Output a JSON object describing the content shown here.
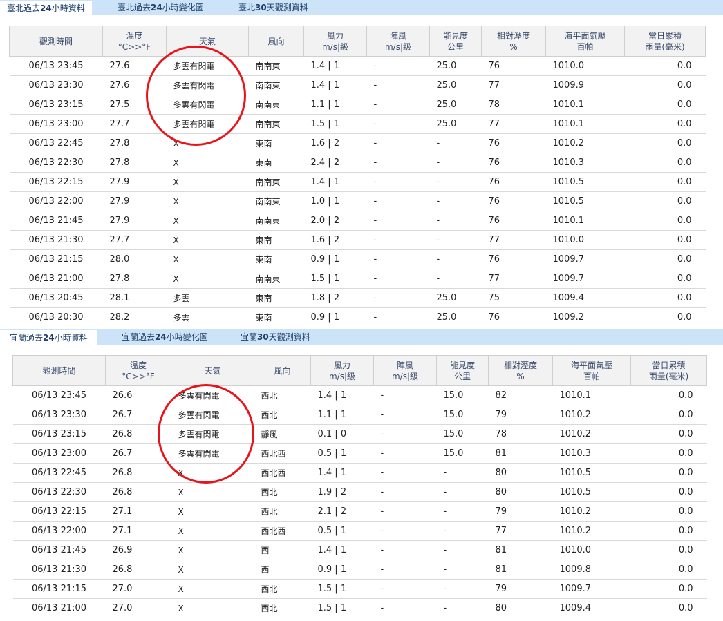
{
  "section1": {
    "tabs": [
      {
        "prefix": "臺北過去",
        "bold": "24",
        "suffix": "小時資料"
      },
      {
        "prefix": "臺北過去",
        "bold": "24",
        "suffix": "小時變化圖"
      },
      {
        "prefix": "臺北",
        "bold": "30",
        "suffix": "天觀測資料"
      }
    ],
    "headers": [
      [
        "觀測時間"
      ],
      [
        "溫度",
        "°C>>°F"
      ],
      [
        "天氣"
      ],
      [
        "風向"
      ],
      [
        "風力",
        "m/s|級"
      ],
      [
        "陣風",
        "m/s|級"
      ],
      [
        "能見度",
        "公里"
      ],
      [
        "相對溼度",
        "%"
      ],
      [
        "海平面氣壓",
        "百帕"
      ],
      [
        "當日累積",
        "雨量(毫米)"
      ]
    ],
    "rows": [
      [
        "06/13 23:45",
        "27.6",
        "多雲有閃電",
        "南南東",
        "1.4 | 1",
        "-",
        "25.0",
        "76",
        "1010.0",
        "0.0"
      ],
      [
        "06/13 23:30",
        "27.6",
        "多雲有閃電",
        "南南東",
        "1.4 | 1",
        "-",
        "25.0",
        "77",
        "1009.9",
        "0.0"
      ],
      [
        "06/13 23:15",
        "27.5",
        "多雲有閃電",
        "南南東",
        "1.1 | 1",
        "-",
        "25.0",
        "78",
        "1010.1",
        "0.0"
      ],
      [
        "06/13 23:00",
        "27.7",
        "多雲有閃電",
        "南南東",
        "1.5 | 1",
        "-",
        "25.0",
        "77",
        "1010.1",
        "0.0"
      ],
      [
        "06/13 22:45",
        "27.8",
        "X",
        "東南",
        "1.6 | 2",
        "-",
        "-",
        "76",
        "1010.2",
        "0.0"
      ],
      [
        "06/13 22:30",
        "27.8",
        "X",
        "東南",
        "2.4 | 2",
        "-",
        "-",
        "76",
        "1010.3",
        "0.0"
      ],
      [
        "06/13 22:15",
        "27.9",
        "X",
        "南南東",
        "1.4 | 1",
        "-",
        "-",
        "76",
        "1010.5",
        "0.0"
      ],
      [
        "06/13 22:00",
        "27.9",
        "X",
        "南南東",
        "1.0 | 1",
        "-",
        "-",
        "76",
        "1010.5",
        "0.0"
      ],
      [
        "06/13 21:45",
        "27.9",
        "X",
        "南南東",
        "2.0 | 2",
        "-",
        "-",
        "76",
        "1010.1",
        "0.0"
      ],
      [
        "06/13 21:30",
        "27.7",
        "X",
        "東南",
        "1.6 | 2",
        "-",
        "-",
        "77",
        "1010.0",
        "0.0"
      ],
      [
        "06/13 21:15",
        "28.0",
        "X",
        "東南",
        "0.9 | 1",
        "-",
        "-",
        "76",
        "1009.7",
        "0.0"
      ],
      [
        "06/13 21:00",
        "27.8",
        "X",
        "南南東",
        "1.5 | 1",
        "-",
        "-",
        "77",
        "1009.7",
        "0.0"
      ],
      [
        "06/13 20:45",
        "28.1",
        "多雲",
        "東南",
        "1.8 | 2",
        "-",
        "25.0",
        "75",
        "1009.4",
        "0.0"
      ],
      [
        "06/13 20:30",
        "28.2",
        "多雲",
        "東南",
        "0.9 | 1",
        "-",
        "25.0",
        "76",
        "1009.2",
        "0.0"
      ]
    ]
  },
  "section2": {
    "tabs": [
      {
        "prefix": "宜蘭過去",
        "bold": "24",
        "suffix": "小時資料"
      },
      {
        "prefix": "宜蘭過去",
        "bold": "24",
        "suffix": "小時變化圖"
      },
      {
        "prefix": "宜蘭",
        "bold": "30",
        "suffix": "天觀測資料"
      }
    ],
    "headers": [
      [
        "觀測時間"
      ],
      [
        "溫度",
        "°C>>°F"
      ],
      [
        "天氣"
      ],
      [
        "風向"
      ],
      [
        "風力",
        "m/s|級"
      ],
      [
        "陣風",
        "m/s|級"
      ],
      [
        "能見度",
        "公里"
      ],
      [
        "相對溼度",
        "%"
      ],
      [
        "海平面氣壓",
        "百帕"
      ],
      [
        "當日累積",
        "雨量(毫米)"
      ]
    ],
    "rows": [
      [
        "06/13 23:45",
        "26.6",
        "多雲有閃電",
        "西北",
        "1.4 | 1",
        "-",
        "15.0",
        "82",
        "1010.1",
        "0.0"
      ],
      [
        "06/13 23:30",
        "26.7",
        "多雲有閃電",
        "西北",
        "1.1 | 1",
        "-",
        "15.0",
        "79",
        "1010.2",
        "0.0"
      ],
      [
        "06/13 23:15",
        "26.8",
        "多雲有閃電",
        "靜風",
        "0.1 | 0",
        "-",
        "15.0",
        "78",
        "1010.2",
        "0.0"
      ],
      [
        "06/13 23:00",
        "26.7",
        "多雲有閃電",
        "西北西",
        "0.5 | 1",
        "-",
        "15.0",
        "81",
        "1010.3",
        "0.0"
      ],
      [
        "06/13 22:45",
        "26.8",
        "X",
        "西北西",
        "1.4 | 1",
        "-",
        "-",
        "80",
        "1010.5",
        "0.0"
      ],
      [
        "06/13 22:30",
        "26.8",
        "X",
        "西北",
        "1.9 | 2",
        "-",
        "-",
        "80",
        "1010.5",
        "0.0"
      ],
      [
        "06/13 22:15",
        "27.1",
        "X",
        "西北",
        "2.1 | 2",
        "-",
        "-",
        "79",
        "1010.2",
        "0.0"
      ],
      [
        "06/13 22:00",
        "27.1",
        "X",
        "西北西",
        "0.5 | 1",
        "-",
        "-",
        "77",
        "1010.2",
        "0.0"
      ],
      [
        "06/13 21:45",
        "26.9",
        "X",
        "西",
        "1.4 | 1",
        "-",
        "-",
        "81",
        "1010.0",
        "0.0"
      ],
      [
        "06/13 21:30",
        "26.8",
        "X",
        "西",
        "0.9 | 1",
        "-",
        "-",
        "81",
        "1009.8",
        "0.0"
      ],
      [
        "06/13 21:15",
        "27.0",
        "X",
        "西北",
        "1.5 | 1",
        "-",
        "-",
        "79",
        "1009.7",
        "0.0"
      ],
      [
        "06/13 21:00",
        "27.0",
        "X",
        "西北",
        "1.5 | 1",
        "-",
        "-",
        "80",
        "1009.4",
        "0.0"
      ]
    ]
  },
  "annotations": {
    "circle_color": "#e8141a"
  },
  "colors": {
    "tab_bar": "#cde4f8",
    "tab_text": "#1d3e6a",
    "header_bg": "#f2f2f2"
  }
}
